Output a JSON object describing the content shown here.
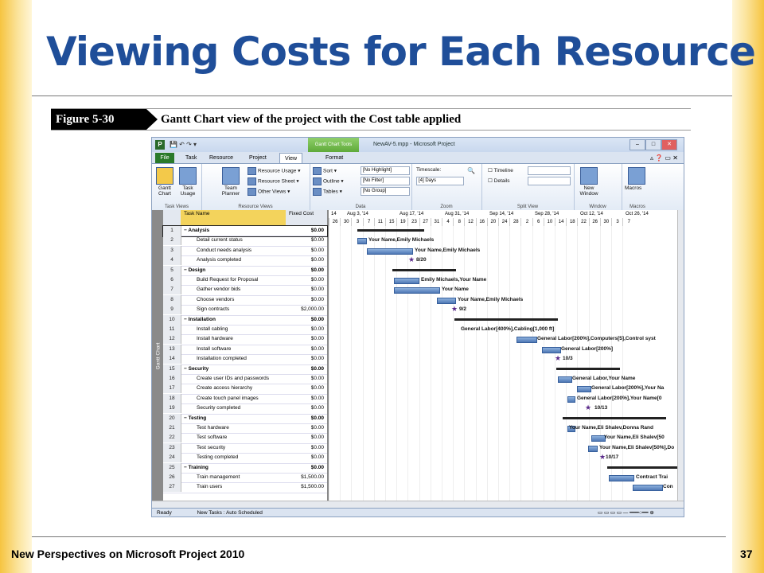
{
  "slide": {
    "title": "Viewing Costs for Each Resource",
    "footer": "New Perspectives on Microsoft Project 2010",
    "page_number": "37",
    "figure_label": "Figure 5-30",
    "figure_caption": "Gantt Chart view of the project with the Cost table applied"
  },
  "window": {
    "title": "NewAV-5.mpp - Microsoft Project",
    "context_tab": "Gantt Chart Tools",
    "buttons": [
      "–",
      "□",
      "✕"
    ]
  },
  "ribbon": {
    "tabs": [
      "File",
      "Task",
      "Resource",
      "Project",
      "View",
      "Format"
    ],
    "active_tab": "View",
    "task_views": {
      "label": "Task Views",
      "gantt": "Gantt Chart",
      "task_usage": "Task Usage"
    },
    "resource_views": {
      "label": "Resource Views",
      "team_planner": "Team Planner",
      "resource_usage": "Resource Usage",
      "resource_sheet": "Resource Sheet",
      "other_views": "Other Views"
    },
    "data": {
      "label": "Data",
      "sort": "Sort",
      "outline": "Outline",
      "tables": "Tables",
      "highlight": "[No Highlight]",
      "filter": "[No Filter]",
      "group": "[No Group]"
    },
    "zoom": {
      "label": "Zoom",
      "timescale_label": "Timescale:",
      "timescale_value": "[4] Days"
    },
    "split_view": {
      "label": "Split View",
      "timeline": "Timeline",
      "details": "Details"
    },
    "window": {
      "label": "Window",
      "new_window": "New Window"
    },
    "macros": {
      "label": "Macros",
      "macros": "Macros"
    }
  },
  "sheet": {
    "vertical_label": "Gantt Chart",
    "col_task": "Task Name",
    "col_cost": "Fixed Cost",
    "rows": [
      {
        "id": "1",
        "name": "Analysis",
        "cost": "$0.00",
        "summary": true
      },
      {
        "id": "2",
        "name": "Detail current status",
        "cost": "$0.00",
        "summary": false
      },
      {
        "id": "3",
        "name": "Conduct needs analysis",
        "cost": "$0.00",
        "summary": false
      },
      {
        "id": "4",
        "name": "Analysis completed",
        "cost": "$0.00",
        "summary": false
      },
      {
        "id": "5",
        "name": "Design",
        "cost": "$0.00",
        "summary": true
      },
      {
        "id": "6",
        "name": "Build Request for Proposal",
        "cost": "$0.00",
        "summary": false
      },
      {
        "id": "7",
        "name": "Gather vendor bids",
        "cost": "$0.00",
        "summary": false
      },
      {
        "id": "8",
        "name": "Choose vendors",
        "cost": "$0.00",
        "summary": false
      },
      {
        "id": "9",
        "name": "Sign contracts",
        "cost": "$2,000.00",
        "summary": false
      },
      {
        "id": "10",
        "name": "Installation",
        "cost": "$0.00",
        "summary": true
      },
      {
        "id": "11",
        "name": "Install cabling",
        "cost": "$0.00",
        "summary": false
      },
      {
        "id": "12",
        "name": "Install hardware",
        "cost": "$0.00",
        "summary": false
      },
      {
        "id": "13",
        "name": "Install software",
        "cost": "$0.00",
        "summary": false
      },
      {
        "id": "14",
        "name": "Installation completed",
        "cost": "$0.00",
        "summary": false
      },
      {
        "id": "15",
        "name": "Security",
        "cost": "$0.00",
        "summary": true
      },
      {
        "id": "16",
        "name": "Create user IDs and passwords",
        "cost": "$0.00",
        "summary": false
      },
      {
        "id": "17",
        "name": "Create access hierarchy",
        "cost": "$0.00",
        "summary": false
      },
      {
        "id": "18",
        "name": "Create touch panel images",
        "cost": "$0.00",
        "summary": false
      },
      {
        "id": "19",
        "name": "Security completed",
        "cost": "$0.00",
        "summary": false
      },
      {
        "id": "20",
        "name": "Testing",
        "cost": "$0.00",
        "summary": true
      },
      {
        "id": "21",
        "name": "Test hardware",
        "cost": "$0.00",
        "summary": false
      },
      {
        "id": "22",
        "name": "Test software",
        "cost": "$0.00",
        "summary": false
      },
      {
        "id": "23",
        "name": "Test security",
        "cost": "$0.00",
        "summary": false
      },
      {
        "id": "24",
        "name": "Testing completed",
        "cost": "$0.00",
        "summary": false
      },
      {
        "id": "25",
        "name": "Training",
        "cost": "$0.00",
        "summary": true
      },
      {
        "id": "26",
        "name": "Train management",
        "cost": "$1,500.00",
        "summary": false
      },
      {
        "id": "27",
        "name": "Train users",
        "cost": "$1,500.00",
        "summary": false
      }
    ]
  },
  "gantt": {
    "weeks": [
      "14",
      "Aug 3, '14",
      "Aug 17, '14",
      "Aug 31, '14",
      "Sep 14, '14",
      "Sep 28, '14",
      "Oct 12, '14",
      "Oct 26, '14"
    ],
    "days": [
      "26",
      "30",
      "3",
      "7",
      "11",
      "15",
      "19",
      "23",
      "27",
      "31",
      "4",
      "8",
      "12",
      "16",
      "20",
      "24",
      "28",
      "2",
      "6",
      "10",
      "14",
      "18",
      "22",
      "26",
      "30",
      "3",
      "7"
    ],
    "labels": [
      "Your Name,Emily Michaels",
      "Your Name,Emily Michaels",
      "8/20",
      "Emily Michaels,Your Name",
      "Your Name",
      "Your Name,Emily Michaels",
      "9/2",
      "General Labor[400%],Cabling[1,000 ft]",
      "General Labor[200%],Computers[5],Control syst",
      "General Labor[200%]",
      "10/3",
      "General Labor,Your Name",
      "General Labor[200%],Your Na",
      "General Labor[200%],Your Name[0",
      "10/13",
      "Your Name,Eli Shalev,Donna Rand",
      "Your Name,Eli Shalev[50",
      "Your Name,Eli Shalev[50%],Do",
      "10/17",
      "Contract Trai",
      "Con"
    ]
  },
  "statusbar": {
    "ready": "Ready",
    "new_tasks": "New Tasks : Auto Scheduled"
  }
}
